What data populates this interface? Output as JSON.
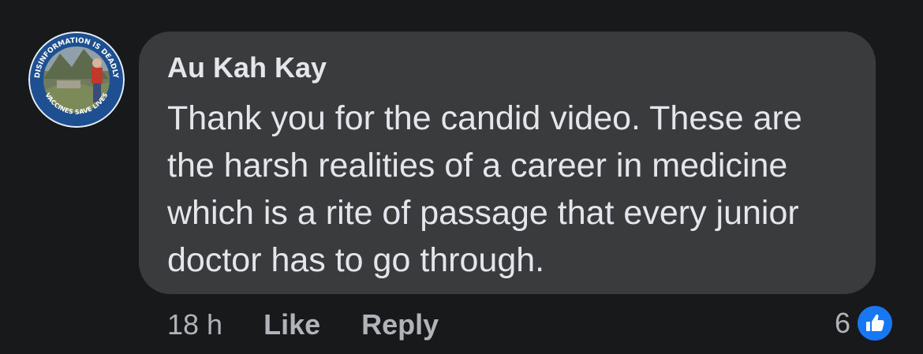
{
  "avatar": {
    "badge_top_text": "DISINFORMATION IS DEADLY",
    "badge_bottom_text": "VACCINES SAVE LIVES",
    "ring_color": "#1d4f91"
  },
  "comment": {
    "author": "Au Kah Kay",
    "lines": [
      "Thank you for the candid video. These are",
      "the harsh realities of a career in medicine",
      "which is a rite of passage that every junior",
      "doctor has to go through."
    ]
  },
  "actions": {
    "timestamp": "18 h",
    "like_label": "Like",
    "reply_label": "Reply"
  },
  "reactions": {
    "count": "6",
    "icon": "thumbs-up-icon",
    "icon_color": "#1877f2"
  }
}
